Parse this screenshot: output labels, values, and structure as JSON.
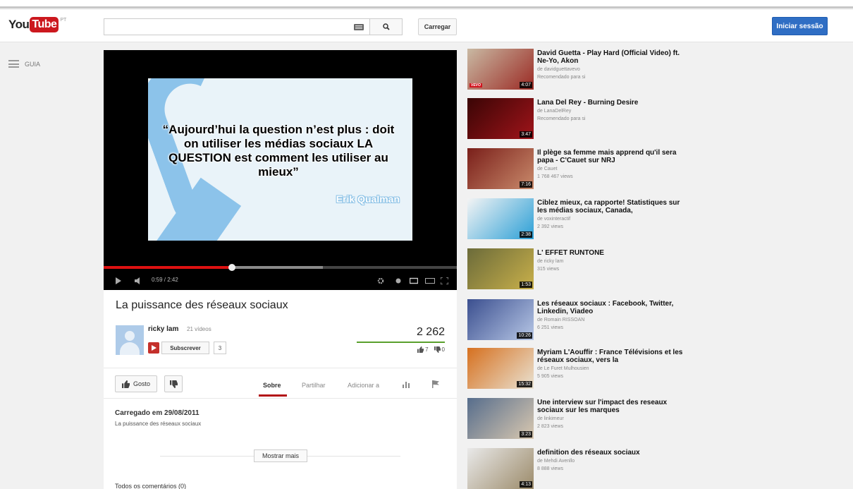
{
  "masthead": {
    "logo_you": "You",
    "logo_tube": "Tube",
    "logo_country": "PT",
    "search_placeholder": "",
    "upload_label": "Carregar",
    "signin_label": "Iniciar sessão"
  },
  "guide": {
    "label": "GUIA"
  },
  "player": {
    "quote": "“Aujourd’hui la question n’est plus : doit on utiliser les médias  sociaux LA QUESTION est comment les utiliser au mieux”",
    "quote_author": "Erik Qualman",
    "time_current": "0:59",
    "time_total": "2:42",
    "played_fraction": 0.364,
    "buffered_fraction": 0.62
  },
  "video": {
    "title": "La puissance des réseaux sociaux",
    "channel": "ricky lam",
    "video_count": "21 vídeos",
    "subscribe_label": "Subscrever",
    "subscriber_count": "3",
    "views": "2 262",
    "likes": "7",
    "dislikes": "0",
    "like_fraction": 1.0
  },
  "actions": {
    "like_label": "Gosto",
    "tabs": [
      "Sobre",
      "Partilhar",
      "Adicionar a"
    ]
  },
  "description": {
    "upload_date": "Carregado em 29/08/2011",
    "text": "La puissance des réseaux sociaux",
    "more_label": "Mostrar mais",
    "comments_header": "Todos os comentários (0)"
  },
  "recommendations": [
    {
      "title": "David Guetta - Play Hard (Official Video) ft. Ne-Yo, Akon",
      "channel": "de davidguettavevo",
      "meta": "Recomendado para si",
      "duration": "4:07",
      "vevo": "VEVO",
      "colors": [
        "#c9b9a3",
        "#9b2a24"
      ]
    },
    {
      "title": "Lana Del Rey - Burning Desire",
      "channel": "de LanaDelRey",
      "meta": "Recomendado para si",
      "duration": "3:47",
      "vevo": "",
      "colors": [
        "#3a0505",
        "#a0141a"
      ]
    },
    {
      "title": "Il plège sa femme mais apprend qu'il sera papa - C'Cauet sur NRJ",
      "channel": "de Cauet",
      "meta": "1 768 467 views",
      "duration": "7:16",
      "vevo": "",
      "colors": [
        "#7a1f1a",
        "#c98a6b"
      ]
    },
    {
      "title": "Ciblez mieux, ca rapporte! Statistiques sur les médias sociaux, Canada,",
      "channel": "de voxinteractif",
      "meta": "2 392 views",
      "duration": "2:38",
      "vevo": "",
      "colors": [
        "#f4f4f4",
        "#2b9fd6"
      ]
    },
    {
      "title": "L' EFFET RUNTONE",
      "channel": "de ricky lam",
      "meta": "315 views",
      "duration": "1:53",
      "vevo": "",
      "colors": [
        "#6b6b3a",
        "#c9b04a"
      ]
    },
    {
      "title": "Les réseaux sociaux : Facebook, Twitter, Linkedin, Viadeo",
      "channel": "de Romain RISSOAN",
      "meta": "6 251 views",
      "duration": "10:26",
      "vevo": "",
      "colors": [
        "#3b4f8f",
        "#b7c7e6"
      ]
    },
    {
      "title": "Myriam L'Aouffir : France Télévisions et les réseaux sociaux, vers la",
      "channel": "de Le Furet Mulhousien",
      "meta": "5 905 views",
      "duration": "15:32",
      "vevo": "",
      "colors": [
        "#d6701f",
        "#e9e2d2"
      ]
    },
    {
      "title": "Une interview sur l'impact des reseaux sociaux sur les marques",
      "channel": "de linkimeur",
      "meta": "2 823 views",
      "duration": "3:23",
      "vevo": "",
      "colors": [
        "#566d8c",
        "#d9c8b0"
      ]
    },
    {
      "title": "definition des réseaux sociaux",
      "channel": "de Mehdi Avenllo",
      "meta": "8 888 views",
      "duration": "4:13",
      "vevo": "",
      "colors": [
        "#e9e9e9",
        "#9c8b6a"
      ]
    }
  ]
}
